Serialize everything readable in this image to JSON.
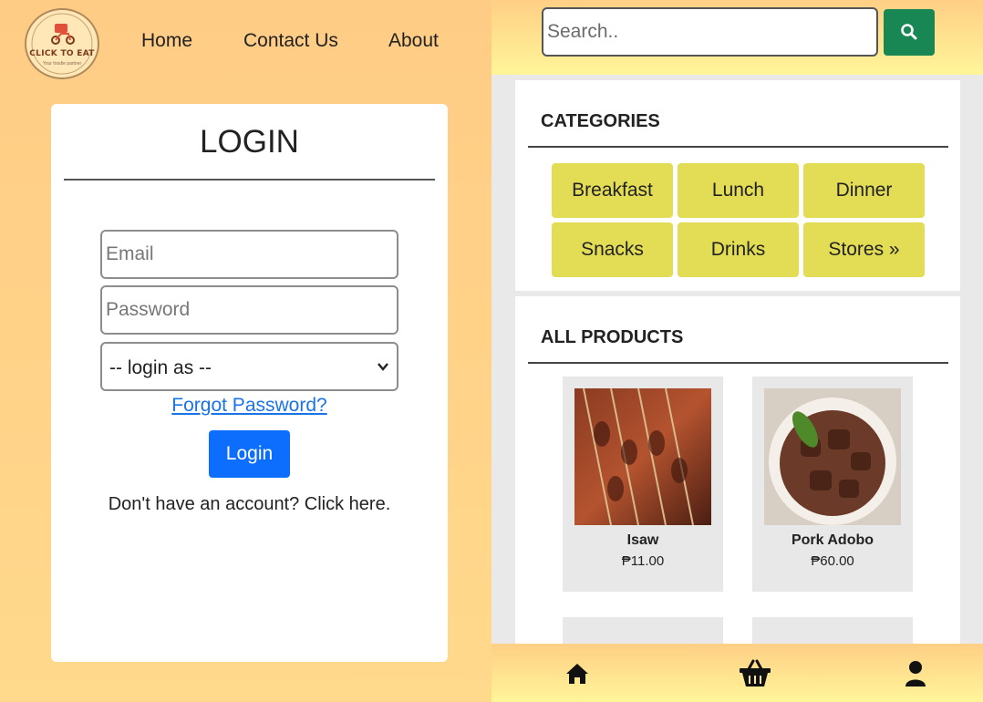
{
  "brand": {
    "logo_text": "CLICK TO EAT",
    "logo_tagline": "Your foodie partner"
  },
  "nav": {
    "home": "Home",
    "contact": "Contact Us",
    "about": "About"
  },
  "login": {
    "title": "LOGIN",
    "email_placeholder": "Email",
    "password_placeholder": "Password",
    "login_as_value": "-- login as --",
    "forgot_password": "Forgot Password?",
    "login_button": "Login",
    "signup_text": "Don't have an account? Click here."
  },
  "search": {
    "placeholder": "Search.."
  },
  "categories": {
    "heading": "CATEGORIES",
    "items": [
      "Breakfast",
      "Lunch",
      "Dinner",
      "Snacks",
      "Drinks",
      "Stores »"
    ]
  },
  "products": {
    "heading": "ALL PRODUCTS",
    "items": [
      {
        "name": "Isaw",
        "price": "₱11.00"
      },
      {
        "name": "Pork Adobo",
        "price": "₱60.00"
      }
    ]
  },
  "icons": {
    "search_button": "search-icon",
    "bottom_nav": [
      "home-icon",
      "basket-icon",
      "user-icon"
    ],
    "select_arrow": "chevron-down-icon"
  },
  "colors": {
    "search_button": "#198754",
    "login_button": "#0d6efd",
    "category_button": "#e3dc55",
    "link": "#1a73e8"
  }
}
